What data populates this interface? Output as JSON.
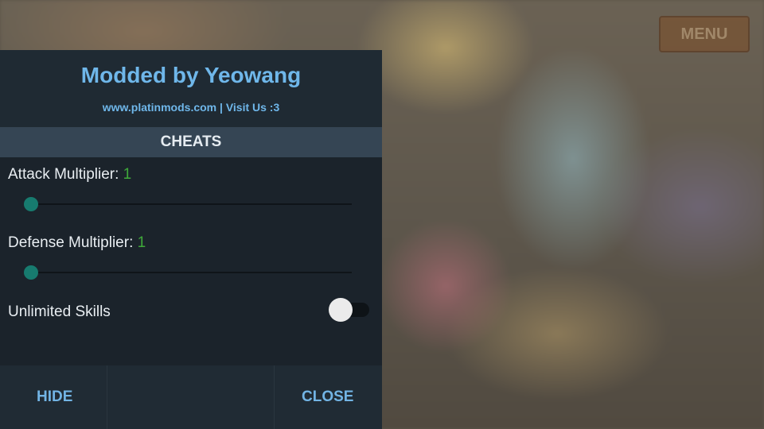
{
  "background": {
    "menu_label": "MENU"
  },
  "panel": {
    "title": "Modded by Yeowang",
    "subtitle": "www.platinmods.com | Visit Us :3",
    "section_title": "CHEATS",
    "attack": {
      "label": "Attack Multiplier: ",
      "value": "1",
      "level": 0
    },
    "defense": {
      "label": "Defense Multiplier: ",
      "value": "1",
      "level": 0
    },
    "unlimited_skills": {
      "label": "Unlimited Skills",
      "enabled": false
    },
    "footer": {
      "hide_label": "HIDE",
      "close_label": "CLOSE"
    }
  },
  "colors": {
    "accent": "#6fb7ea",
    "value_green": "#3fa93a",
    "slider_thumb": "#177b6f"
  }
}
